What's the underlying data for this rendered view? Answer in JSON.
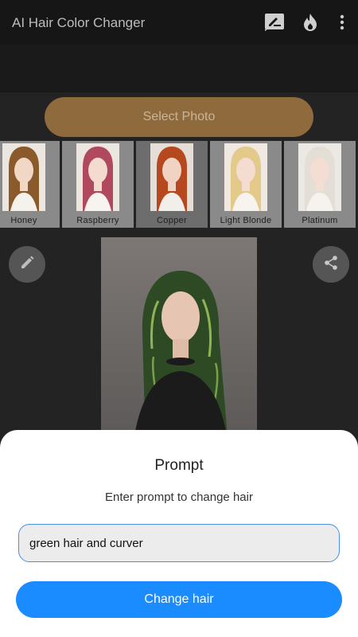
{
  "appbar": {
    "title": "AI Hair Color Changer",
    "icons": [
      "draw-icon",
      "fire-icon",
      "more-vert-icon"
    ]
  },
  "select_photo": {
    "label": "Select Photo"
  },
  "styles": [
    {
      "label": "Honey",
      "hair_color": "#8a5a2b"
    },
    {
      "label": "Raspberry",
      "hair_color": "#b0485e"
    },
    {
      "label": "Copper",
      "hair_color": "#b5481f"
    },
    {
      "label": "Light Blonde",
      "hair_color": "#e3c98a"
    },
    {
      "label": "Platinum",
      "hair_color": "#e4dfd6"
    }
  ],
  "side_buttons": {
    "edit": "pencil-icon",
    "share": "share-icon"
  },
  "main_photo": {
    "hair_color": "#2e4a25",
    "highlight_color": "#8fb455"
  },
  "sheet": {
    "title": "Prompt",
    "subtitle": "Enter prompt to change hair",
    "input_value": "green hair and curver",
    "button_label": "Change hair"
  },
  "colors": {
    "accent": "#1a8cff",
    "select_button": "#8f6a3d",
    "input_border": "#4a90e2"
  }
}
